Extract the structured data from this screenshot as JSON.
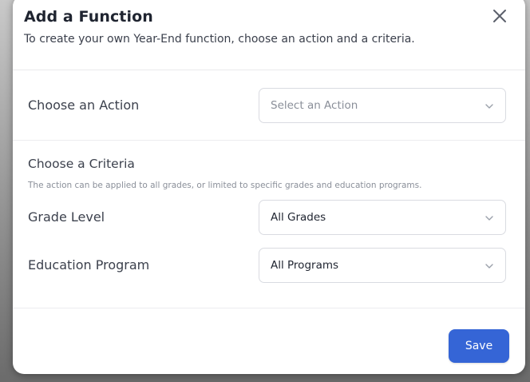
{
  "modal": {
    "title": "Add a Function",
    "subtitle": "To create your own Year-End function, choose an action and a criteria."
  },
  "action": {
    "label": "Choose an Action",
    "select_placeholder": "Select an Action"
  },
  "criteria": {
    "title": "Choose a Criteria",
    "description": "The action can be applied to all grades, or limited to specific grades and education programs.",
    "grade_level": {
      "label": "Grade Level",
      "value": "All Grades"
    },
    "education_program": {
      "label": "Education Program",
      "value": "All Programs"
    }
  },
  "footer": {
    "save_label": "Save"
  },
  "colors": {
    "primary": "#3565d6",
    "text": "#1f2430",
    "muted": "#8a8f99"
  },
  "icons": {
    "close": "close-icon",
    "dropdown": "chevron-down-icon"
  }
}
